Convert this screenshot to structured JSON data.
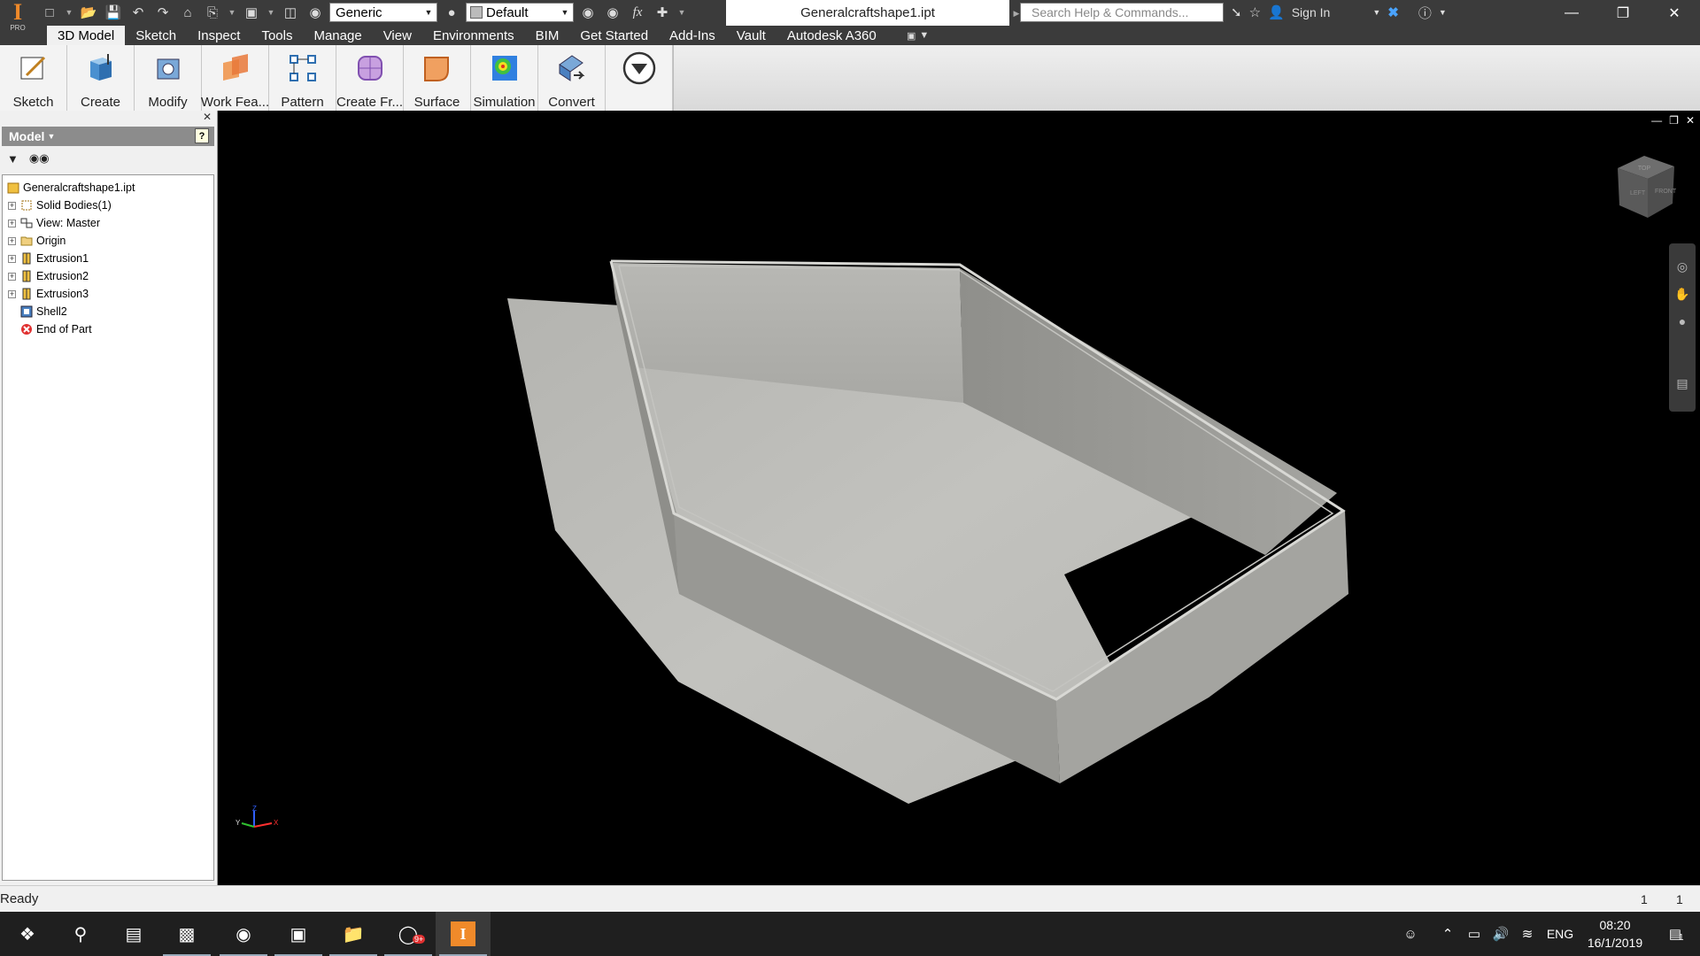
{
  "app": {
    "logo_letter": "I",
    "logo_sub": "PRO",
    "document_title": "Generalcraftshape1.ipt"
  },
  "quick_access": {
    "material_value": "Generic",
    "appearance_value": "Default",
    "fx_label": "fx"
  },
  "search": {
    "placeholder": "Search Help & Commands..."
  },
  "account": {
    "sign_in_label": "Sign In"
  },
  "ribbon_tabs": [
    {
      "label": "3D Model"
    },
    {
      "label": "Sketch"
    },
    {
      "label": "Inspect"
    },
    {
      "label": "Tools"
    },
    {
      "label": "Manage"
    },
    {
      "label": "View"
    },
    {
      "label": "Environments"
    },
    {
      "label": "BIM"
    },
    {
      "label": "Get Started"
    },
    {
      "label": "Add-Ins"
    },
    {
      "label": "Vault"
    },
    {
      "label": "Autodesk A360"
    }
  ],
  "ribbon_buttons": [
    {
      "label": "Sketch",
      "icon": "sketch-icon"
    },
    {
      "label": "Create",
      "icon": "create-icon"
    },
    {
      "label": "Modify",
      "icon": "modify-icon"
    },
    {
      "label": "Work Fea...",
      "icon": "work-features-icon"
    },
    {
      "label": "Pattern",
      "icon": "pattern-icon"
    },
    {
      "label": "Create Fr...",
      "icon": "create-freeform-icon"
    },
    {
      "label": "Surface",
      "icon": "surface-icon"
    },
    {
      "label": "Simulation",
      "icon": "simulation-icon"
    },
    {
      "label": "Convert",
      "icon": "convert-icon"
    }
  ],
  "browser": {
    "title": "Model",
    "help_glyph": "?",
    "items": [
      {
        "label": "Generalcraftshape1.ipt",
        "icon": "part-file-icon",
        "expandable": false,
        "indent": 0
      },
      {
        "label": "Solid Bodies(1)",
        "icon": "solid-bodies-icon",
        "expandable": true,
        "indent": 1
      },
      {
        "label": "View: Master",
        "icon": "view-rep-icon",
        "expandable": true,
        "indent": 1
      },
      {
        "label": "Origin",
        "icon": "folder-icon",
        "expandable": true,
        "indent": 1
      },
      {
        "label": "Extrusion1",
        "icon": "extrusion-icon",
        "expandable": true,
        "indent": 1
      },
      {
        "label": "Extrusion2",
        "icon": "extrusion-icon",
        "expandable": true,
        "indent": 1
      },
      {
        "label": "Extrusion3",
        "icon": "extrusion-icon",
        "expandable": true,
        "indent": 1
      },
      {
        "label": "Shell2",
        "icon": "shell-icon",
        "expandable": false,
        "indent": 1
      },
      {
        "label": "End of Part",
        "icon": "end-of-part-icon",
        "expandable": false,
        "indent": 1
      }
    ]
  },
  "viewcube": {
    "top_label": "TOP",
    "front_label": "FRONT",
    "left_label": "LEFT"
  },
  "triad": {
    "x_label": "X",
    "y_label": "Y",
    "z_label": "Z"
  },
  "status": {
    "text": "Ready",
    "count1": "1",
    "count2": "1"
  },
  "taskbar": {
    "notification_badge": "9+",
    "language": "ENG",
    "time": "08:20",
    "date": "16/1/2019",
    "action_center_count": "1"
  },
  "colors": {
    "chrome_dark": "#3b3b3b",
    "accent_orange": "#f08a2a",
    "viewport_bg": "#000000",
    "model_gray": "#a8a8a4"
  }
}
